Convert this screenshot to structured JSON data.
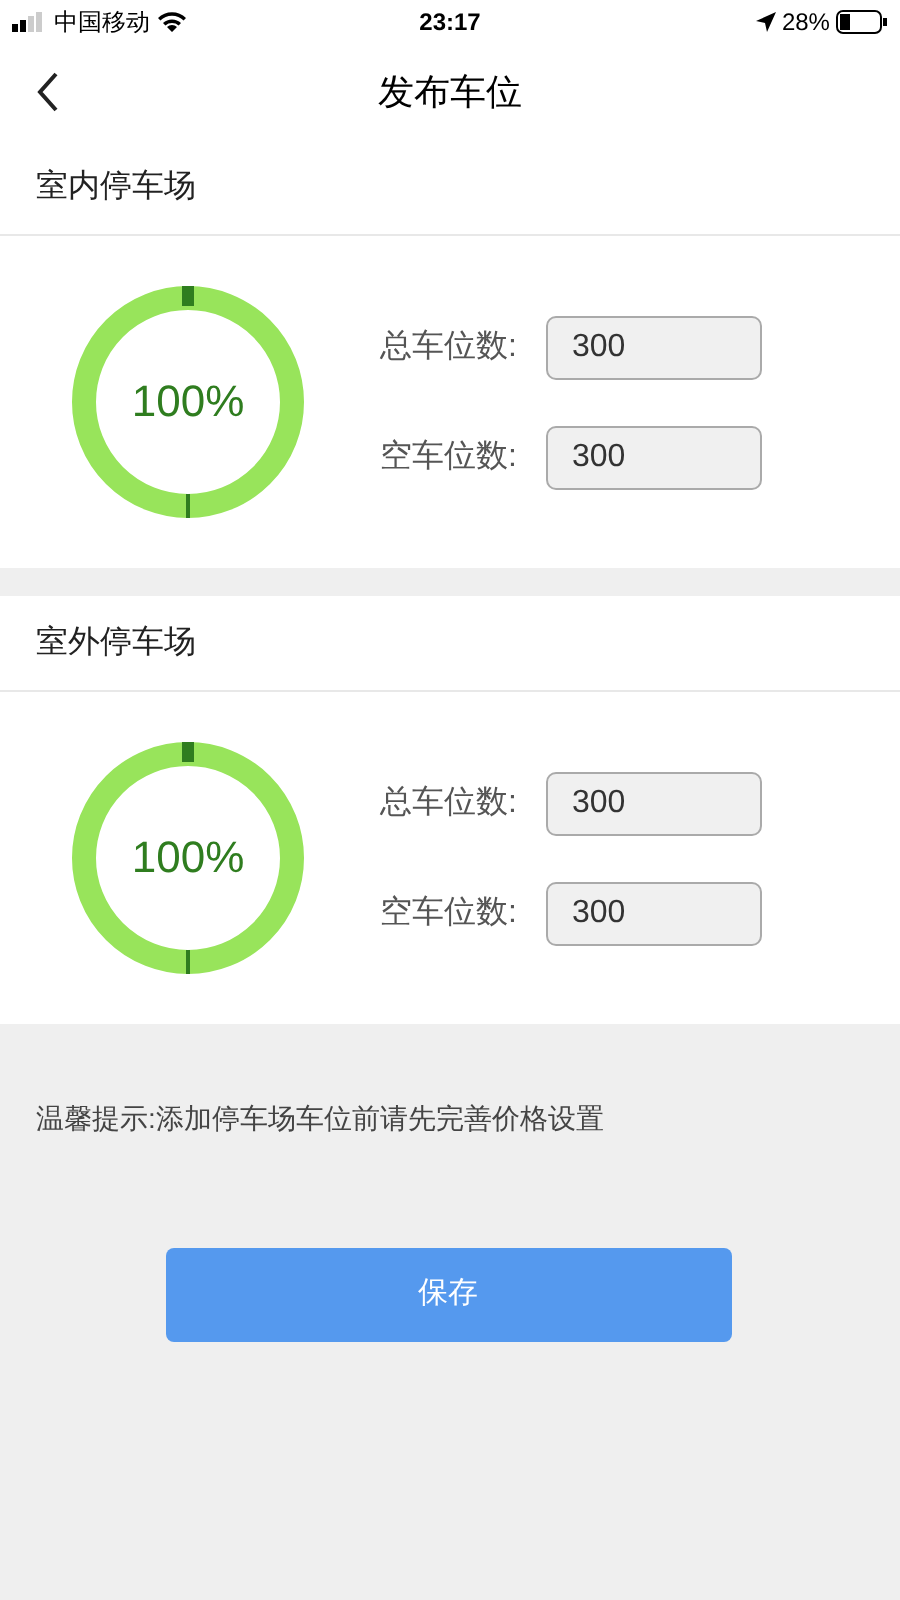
{
  "status_bar": {
    "carrier": "中国移动",
    "time": "23:17",
    "battery": "28%"
  },
  "nav": {
    "title": "发布车位"
  },
  "lots": [
    {
      "title": "室内停车场",
      "percent": "100%",
      "fields": [
        {
          "label": "总车位数:",
          "value": "300"
        },
        {
          "label": "空车位数:",
          "value": "300"
        }
      ]
    },
    {
      "title": "室外停车场",
      "percent": "100%",
      "fields": [
        {
          "label": "总车位数:",
          "value": "300"
        },
        {
          "label": "空车位数:",
          "value": "300"
        }
      ]
    }
  ],
  "tip": "温馨提示:添加停车场车位前请先完善价格设置",
  "save_button": "保存"
}
